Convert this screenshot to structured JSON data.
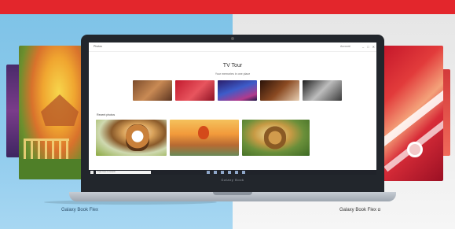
{
  "banner": {
    "accent_color": "#e3262c"
  },
  "laptop": {
    "bezel_label": "Galaxy Book",
    "app": {
      "app_name": "Photos",
      "user_label": "Account",
      "hero_title": "TV Tour",
      "hero_subtitle": "Your memories in one place",
      "albums": [
        {
          "label": ""
        },
        {
          "label": ""
        },
        {
          "label": ""
        },
        {
          "label": ""
        },
        {
          "label": ""
        }
      ],
      "section_label": "Recent photos",
      "photos": [
        {
          "subject": "dog"
        },
        {
          "subject": "hot-air-balloon"
        },
        {
          "subject": "lion"
        }
      ]
    },
    "taskbar": {
      "search_placeholder": "Type here to search",
      "clock": ""
    }
  },
  "captions": {
    "left": "Galaxy Book Flex",
    "right": "Galaxy Book Flex α"
  }
}
